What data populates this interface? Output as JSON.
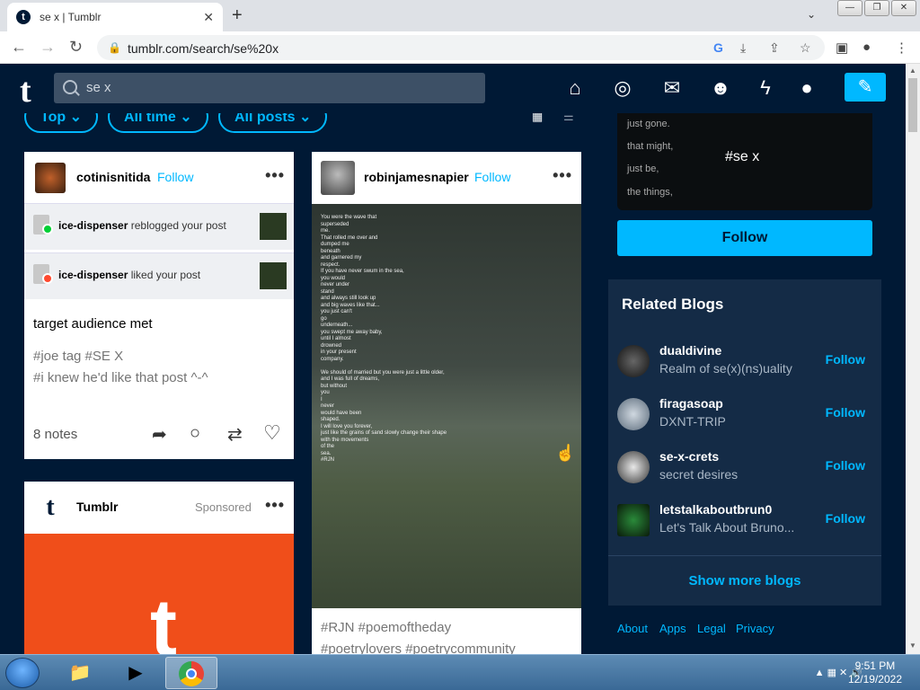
{
  "browser": {
    "tab_title": "se x | Tumblr",
    "url": "tumblr.com/search/se%20x"
  },
  "tumblr": {
    "search_value": "se x",
    "filters": [
      "Top",
      "All time",
      "All posts"
    ]
  },
  "posts": {
    "post1": {
      "blog": "cotinisnitida",
      "follow": "Follow",
      "notifications": [
        {
          "user": "ice-dispenser",
          "action": "reblogged your post"
        },
        {
          "user": "ice-dispenser",
          "action": "liked your post"
        }
      ],
      "body": "target audience met",
      "tags_line1": "#joe tag   #SE X",
      "tags_line2": "#i knew he'd like that post ^-^",
      "notes": "8 notes"
    },
    "post2": {
      "blog": "robinjamesnapier",
      "follow": "Follow",
      "poem": "You were the wave that\nsuperseded\nme.\nThat rolled me over and\ndumped me\nbeneath\nand garnered my\nrespect.\nIf you have never swum in the sea,\nyou would\nnever under\nstand\nand always still look up\nand big waves like that...\nyou just can't\ngo\nunderneath...\nyou swept me away baby,\nuntil I almost\ndrowned\nin your present\ncompany.\n\nWe should of married but you were just a little older,\nand I was full of dreams,\nbut without\nyou\nI\nnever\nwould have been\nshaped.\nI will love you forever,\njust like the grains of sand slowly change their shape\nwith the movements\nof the\nsea.\n#RJN",
      "tags_line1": "#RJN   #poemoftheday",
      "tags_line2": "#poetrylovers   #poetrycommunity"
    },
    "post3": {
      "blog": "Tumblr",
      "sponsored": "Sponsored"
    }
  },
  "sidebar": {
    "tag_lines": [
      "just gone.",
      "that might,",
      "just be,",
      "the things,"
    ],
    "tag_name": "#se x",
    "follow_button": "Follow",
    "related_title": "Related Blogs",
    "related": [
      {
        "name": "dualdivine",
        "desc": "Realm of se(x)(ns)uality",
        "follow": "Follow"
      },
      {
        "name": "firagasoap",
        "desc": "DXNT-TRIP",
        "follow": "Follow"
      },
      {
        "name": "se-x-crets",
        "desc": "secret desires",
        "follow": "Follow"
      },
      {
        "name": "letstalkaboutbrun0",
        "desc": "Let's Talk About Bruno...",
        "follow": "Follow"
      }
    ],
    "show_more": "Show more blogs",
    "footer": [
      "About",
      "Apps",
      "Legal",
      "Privacy"
    ]
  },
  "taskbar": {
    "time": "9:51 PM",
    "date": "12/19/2022"
  },
  "colors": {
    "tumblr_navy": "#001935",
    "accent": "#00b8ff"
  }
}
